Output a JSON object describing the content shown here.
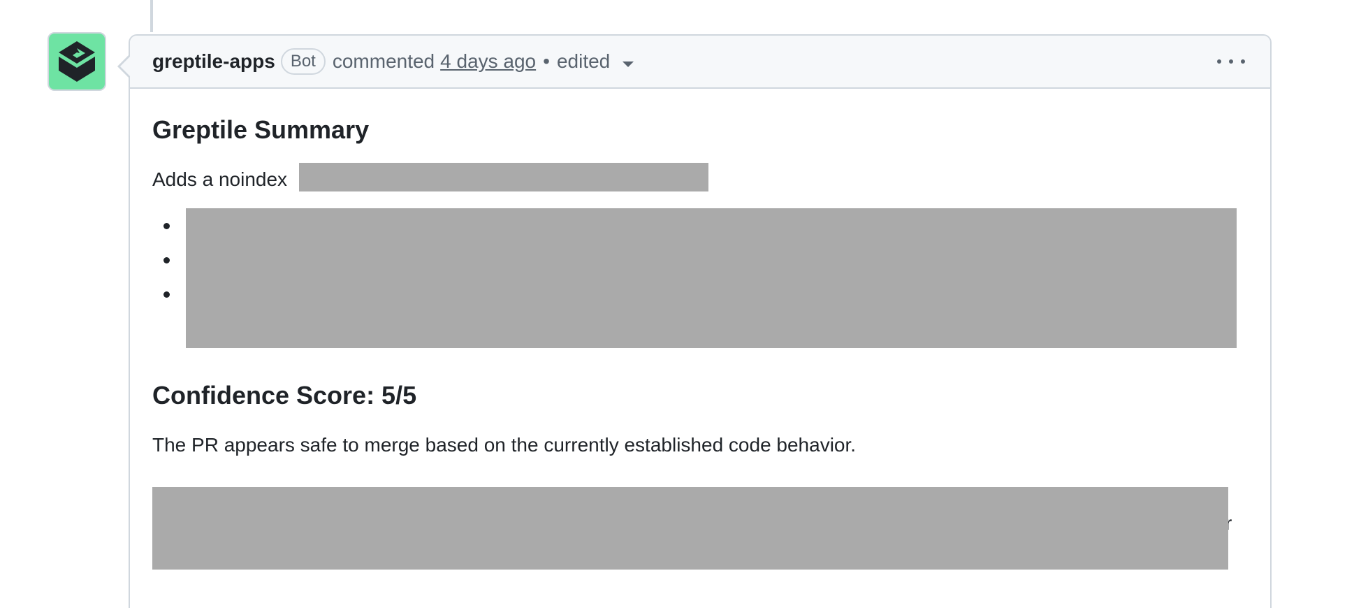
{
  "comment": {
    "author": "greptile-apps",
    "badge": "Bot",
    "action": "commented",
    "timestamp": "4 days ago",
    "separator": "•",
    "edited": "edited",
    "avatar_color": "#6ee3a3",
    "avatar_icon": "greptile-logo-icon"
  },
  "body": {
    "summary_heading": "Greptile Summary",
    "intro_text": "Adds a noindex",
    "confidence_heading": "Confidence Score: 5/5",
    "confidence_text": "The PR appears safe to merge based on the currently established code behavior.",
    "trailing_char": "r",
    "bullet_count": 3,
    "redaction_color": "#aaaaaa"
  }
}
